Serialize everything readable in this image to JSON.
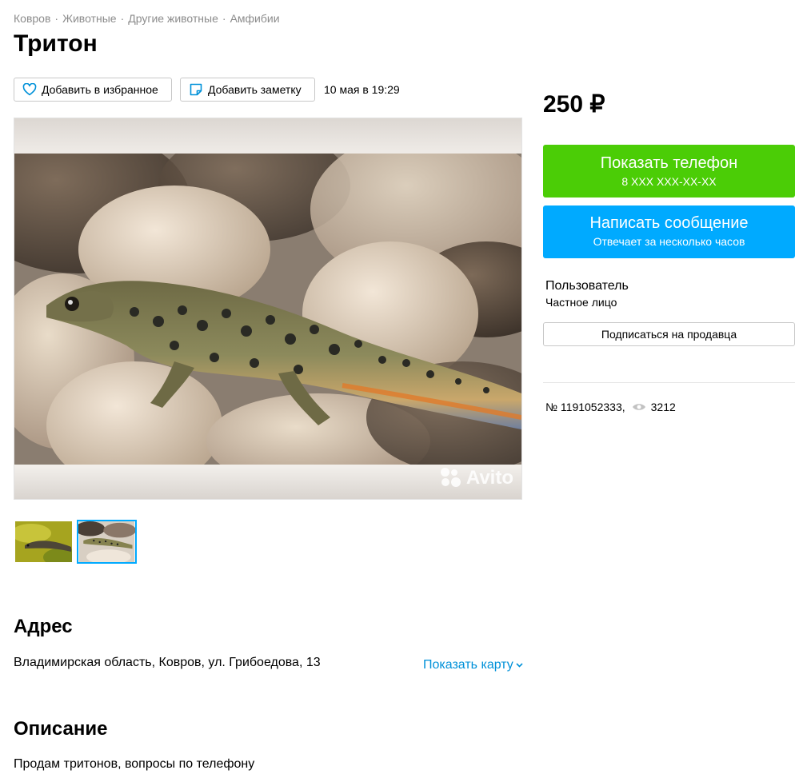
{
  "breadcrumbs": [
    "Ковров",
    "Животные",
    "Другие животные",
    "Амфибии"
  ],
  "title": "Тритон",
  "toolbar": {
    "favorite_label": "Добавить в избранное",
    "note_label": "Добавить заметку",
    "date": "10 мая в 19:29"
  },
  "gallery": {
    "watermark": "Avito",
    "thumbnails_count": 2,
    "active_thumbnail": 2
  },
  "address": {
    "heading": "Адрес",
    "text": "Владимирская область, Ковров, ул. Грибоедова, 13",
    "map_link": "Показать карту"
  },
  "description": {
    "heading": "Описание",
    "text": "Продам тритонов, вопросы по телефону"
  },
  "sidebar": {
    "price": "250 ₽",
    "phone_button": {
      "label": "Показать телефон",
      "sub": "8 XXX XXX-XX-XX"
    },
    "message_button": {
      "label": "Написать сообщение",
      "sub": "Отвечает за несколько часов"
    },
    "seller_name": "Пользователь",
    "seller_type": "Частное лицо",
    "subscribe_label": "Подписаться на продавца",
    "listing_number": "№ 1191052333,",
    "views": "3212"
  },
  "colors": {
    "phone_button": "#4bcd06",
    "message_button": "#00aaff",
    "link": "#0091d9",
    "breadcrumb": "#8c8c8c"
  },
  "icons": [
    "heart-icon",
    "note-icon",
    "chevron-down-icon",
    "eye-icon",
    "avito-logo-icon"
  ]
}
